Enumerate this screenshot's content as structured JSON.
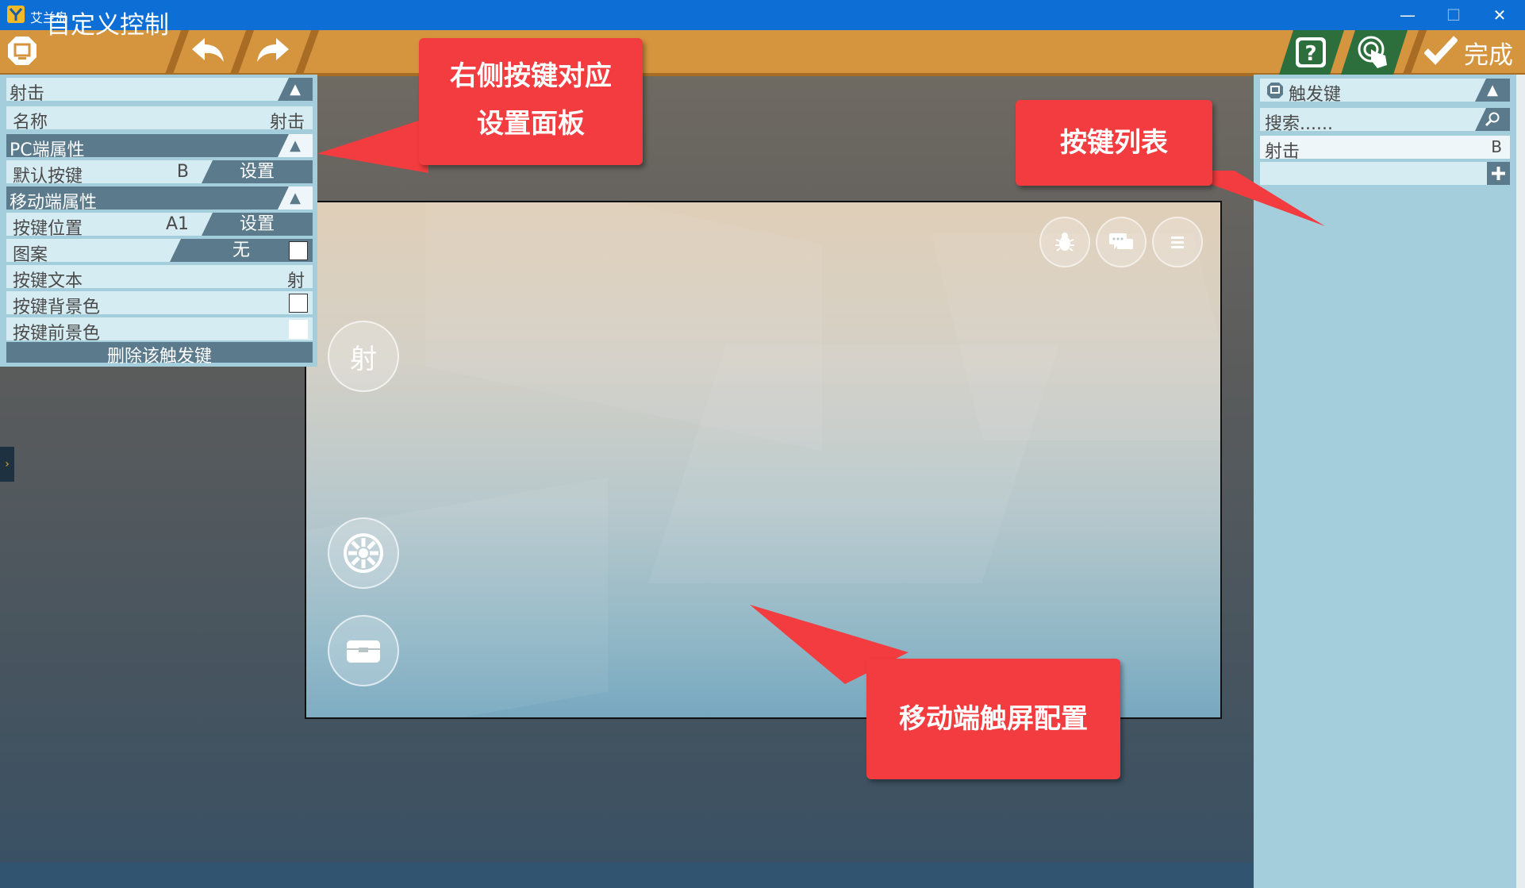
{
  "window": {
    "title": "艾兰岛",
    "controls": [
      "—",
      "☐",
      "✕"
    ]
  },
  "toolbar": {
    "title": "自定义控制",
    "done_label": "完成"
  },
  "left_panel": {
    "section_title": "射击",
    "name_label": "名称",
    "name_value": "射击",
    "pc_header": "PC端属性",
    "default_key_label": "默认按键",
    "default_key_value": "B",
    "set_label": "设置",
    "mobile_header": "移动端属性",
    "key_position_label": "按键位置",
    "key_position_value": "A1",
    "pattern_label": "图案",
    "pattern_value": "无",
    "key_text_label": "按键文本",
    "key_text_value": "射",
    "bg_color_label": "按键背景色",
    "fg_color_label": "按键前景色",
    "delete_label": "删除该触发键"
  },
  "right_panel": {
    "header": "触发键",
    "search_placeholder": "搜索......",
    "items": [
      {
        "label": "射击",
        "key": "B"
      }
    ]
  },
  "phone": {
    "shoot_button": "射"
  },
  "callouts": {
    "left": [
      "右侧按键对应",
      "设置面板"
    ],
    "list": "按键列表",
    "mobile": "移动端触屏配置"
  },
  "colors": {
    "titlebar": "#0d6fd6",
    "toolbar": "#d5953f",
    "panel": "#a5cedd",
    "header": "#5b7b8c",
    "callout": "#f23c3f"
  }
}
